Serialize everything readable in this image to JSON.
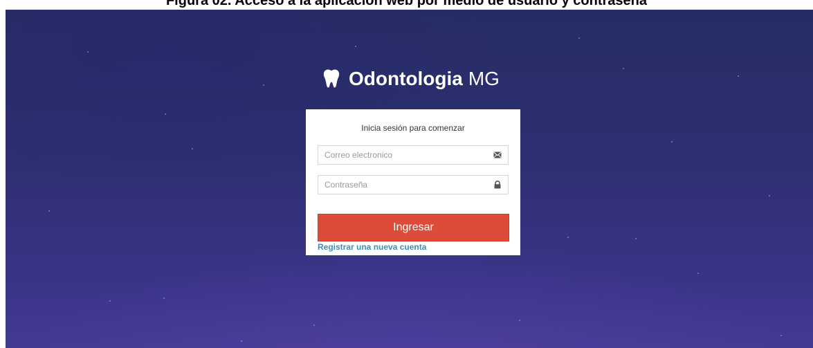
{
  "caption": "Figura 02. Acceso a la aplicación web por medio de usuario y contraseña",
  "brand": {
    "name_bold": "Odontologia",
    "name_light": "MG",
    "icon": "tooth-icon"
  },
  "login": {
    "title": "Inicia sesión para comenzar",
    "email": {
      "placeholder": "Correo electronico",
      "value": "",
      "icon": "envelope-icon"
    },
    "password": {
      "placeholder": "Contraseña",
      "value": "",
      "icon": "lock-icon"
    },
    "submit_label": "Ingresar",
    "register_link": "Registrar una nueva cuenta"
  },
  "colors": {
    "button": "#dd4b39",
    "link": "#3c8dbc",
    "background": "#2e2f72"
  }
}
